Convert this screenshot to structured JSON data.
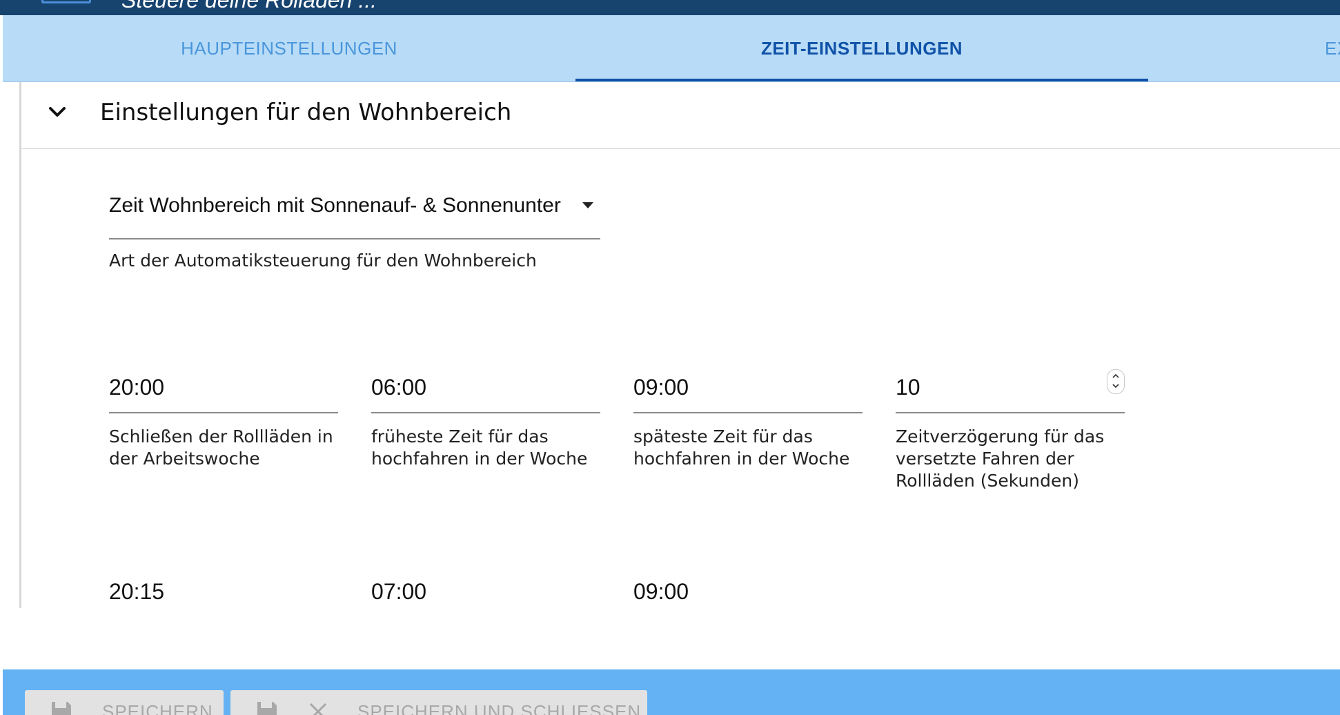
{
  "header": {
    "title": "Steuere deine Rolläden ..."
  },
  "tabs": [
    {
      "label": "HAUPTEINSTELLUNGEN",
      "active": false
    },
    {
      "label": "ZEIT-EINSTELLUNGEN",
      "active": true
    },
    {
      "label": "EX",
      "active": false
    }
  ],
  "panel": {
    "title": "Einstellungen für den Wohnbereich",
    "select": {
      "value": "Zeit Wohnbereich mit Sonnenauf- & Sonnenunter",
      "helper": "Art der Automatiksteuerung für den Wohnbereich"
    },
    "row1": [
      {
        "value": "20:00",
        "helper": "Schließen der Rollläden in der Arbeitswoche"
      },
      {
        "value": "06:00",
        "helper": "früheste Zeit für das hochfahren in der Woche"
      },
      {
        "value": "09:00",
        "helper": "späteste Zeit für das hochfahren in der Woche"
      },
      {
        "value": "10",
        "helper": "Zeitverzögerung für das versetzte Fahren der Rollläden (Sekunden)"
      }
    ],
    "row2": [
      {
        "value": "20:15"
      },
      {
        "value": "07:00"
      },
      {
        "value": "09:00"
      }
    ]
  },
  "footer": {
    "save_label": "SPEICHERN",
    "save_close_label": "SPEICHERN UND SCHLIESSEN"
  },
  "colors": {
    "header_bg": "#17436f",
    "tabbar_bg": "#b8dcf7",
    "tab_active": "#1052a8",
    "tab_inactive": "#4a96db",
    "footer_bg": "#64b2f4"
  }
}
